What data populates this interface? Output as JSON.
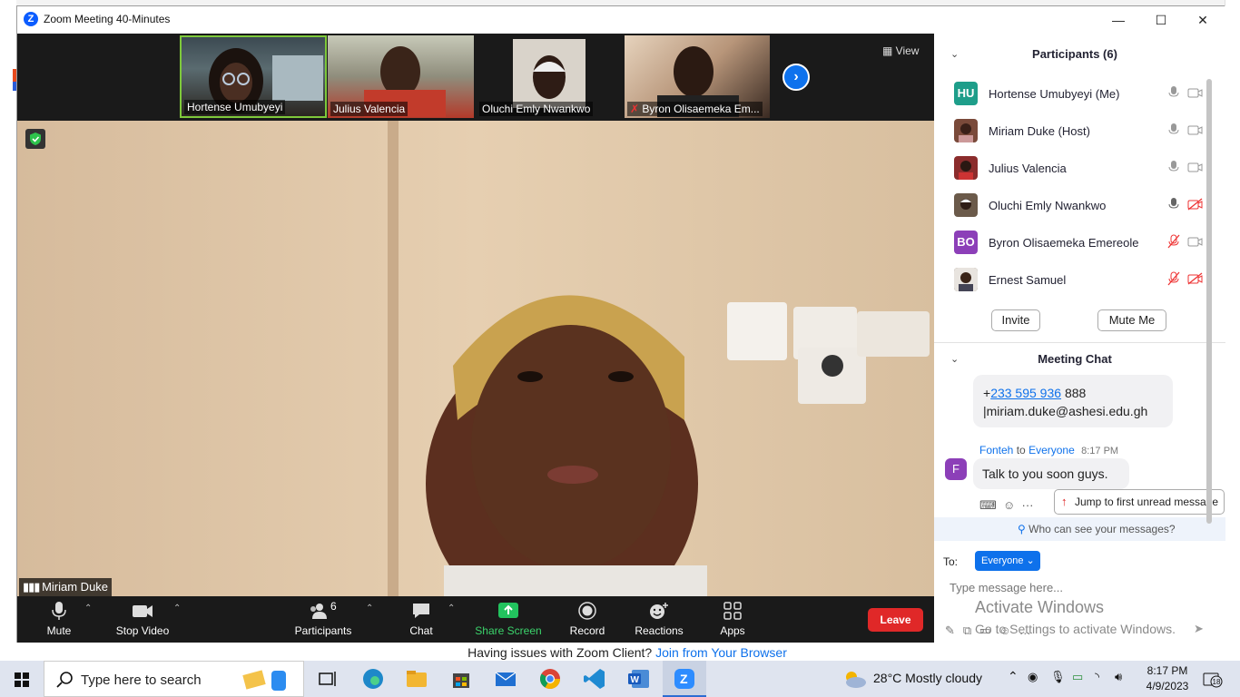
{
  "window": {
    "title": "Zoom Meeting 40-Minutes",
    "minimize": "—",
    "maximize": "☐",
    "close": "✕"
  },
  "filmstrip": {
    "view_label": "View",
    "thumbnails": [
      {
        "name": "Hortense Umubyeyi"
      },
      {
        "name": "Julius Valencia"
      },
      {
        "name": "Oluchi Emly Nwankwo"
      },
      {
        "name": "Byron Olisaemeka Em..."
      }
    ]
  },
  "main_video": {
    "speaker_name": "Miriam Duke"
  },
  "toolbar": {
    "mute": "Mute",
    "stop_video": "Stop Video",
    "participants": "Participants",
    "participants_count": "6",
    "chat": "Chat",
    "share_screen": "Share Screen",
    "record": "Record",
    "reactions": "Reactions",
    "apps": "Apps",
    "leave": "Leave"
  },
  "participants_panel": {
    "title": "Participants (6)",
    "participants": [
      {
        "name": "Hortense Umubyeyi (Me)",
        "initials": "HU",
        "color": "#1e9e8a",
        "mic_muted": false,
        "video_off": false
      },
      {
        "name": "Miriam Duke (Host)",
        "initials": "",
        "color": "#7a4a3a",
        "mic_muted": false,
        "video_off": false
      },
      {
        "name": "Julius Valencia",
        "initials": "",
        "color": "#8b2c2c",
        "mic_muted": false,
        "video_off": false
      },
      {
        "name": "Oluchi Emly Nwankwo",
        "initials": "",
        "color": "#6b5a4a",
        "mic_muted": false,
        "video_off": true
      },
      {
        "name": "Byron Olisaemeka Emereole",
        "initials": "BO",
        "color": "#8c3fb8",
        "mic_muted": true,
        "video_off": false
      },
      {
        "name": "Ernest Samuel",
        "initials": "",
        "color": "#5a4636",
        "mic_muted": true,
        "video_off": true
      }
    ],
    "invite": "Invite",
    "mute_me": "Mute Me"
  },
  "chat": {
    "title": "Meeting Chat",
    "prev_message": {
      "phone_prefix": "+",
      "phone": "233 595 936",
      "phone_suffix": "888",
      "email": "|miriam.duke@ashesi.edu.gh"
    },
    "message": {
      "sender": "Fonteh",
      "to_word": "to",
      "recipient": "Everyone",
      "time": "8:17 PM",
      "avatar_letter": "F",
      "avatar_color": "#8c3fb8",
      "text": "Talk to you soon guys."
    },
    "jump_label": "Jump to first unread message",
    "who_can_see": "Who can see your messages?",
    "to_label": "To:",
    "to_value": "Everyone",
    "input_placeholder": "Type message here...",
    "watermark_title": "Activate Windows",
    "watermark_sub": "Go to Settings to activate Windows."
  },
  "banner": {
    "text": "Having issues with Zoom Client?",
    "link": "Join from Your Browser"
  },
  "taskbar": {
    "search_placeholder": "Type here to search",
    "weather": "28°C  Mostly cloudy",
    "time": "8:17 PM",
    "date": "4/9/2023",
    "notifications": "18"
  }
}
